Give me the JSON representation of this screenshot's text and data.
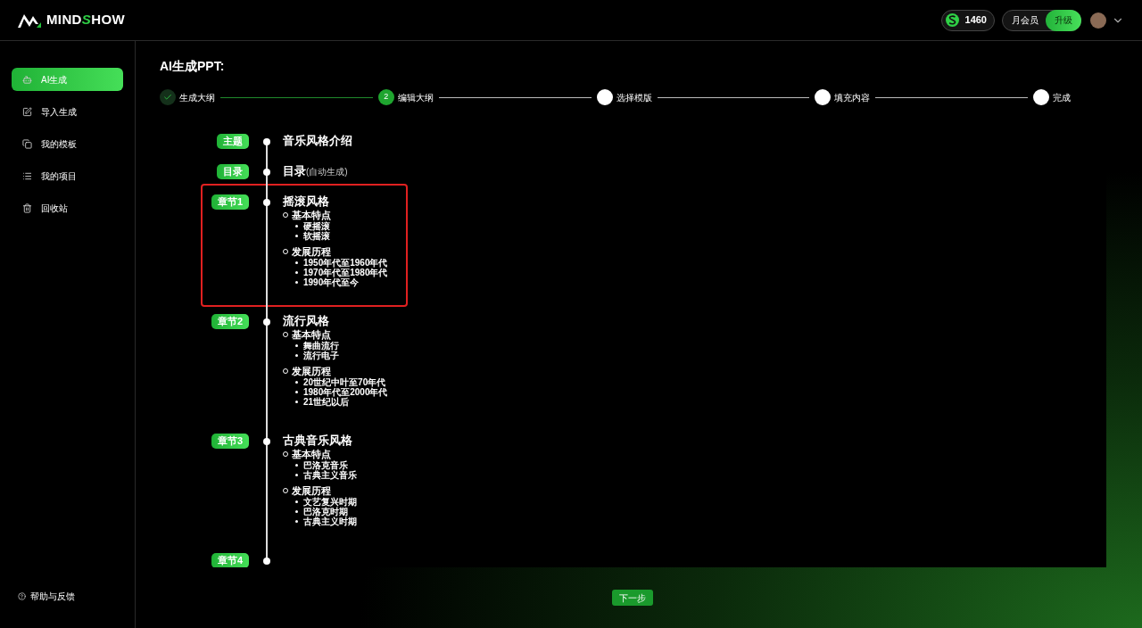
{
  "header": {
    "logo": [
      {
        "text": "MIND",
        "accent": false
      },
      {
        "text": "S",
        "accent": true
      },
      {
        "text": "HOW",
        "accent": false
      }
    ],
    "coins": "1460",
    "membership": "月会员",
    "upgrade": "升级"
  },
  "sidebar": {
    "items": [
      {
        "label": "AI生成",
        "selected": true
      },
      {
        "label": "导入生成",
        "selected": false
      },
      {
        "label": "我的模板",
        "selected": false
      },
      {
        "label": "我的项目",
        "selected": false
      },
      {
        "label": "回收站",
        "selected": false
      }
    ],
    "help": "帮助与反馈"
  },
  "page_title": "AI生成PPT:",
  "steps": [
    {
      "label": "生成大纲",
      "kind": "done"
    },
    {
      "label": "编辑大纲",
      "kind": "current",
      "number": "2"
    },
    {
      "label": "选择模版",
      "kind": "todo"
    },
    {
      "label": "填充内容",
      "kind": "todo"
    },
    {
      "label": "完成",
      "kind": "todo"
    }
  ],
  "outline": [
    {
      "tag": "主题",
      "title": "音乐风格介绍",
      "selected": false
    },
    {
      "tag": "目录",
      "title": "目录",
      "note": "(自动生成)",
      "selected": false
    },
    {
      "tag": "章节1",
      "title": "摇滚风格",
      "selected": true,
      "groups": [
        {
          "title": "基本特点",
          "items": [
            "硬摇滚",
            "软摇滚"
          ]
        },
        {
          "title": "发展历程",
          "items": [
            "1950年代至1960年代",
            "1970年代至1980年代",
            "1990年代至今"
          ]
        }
      ]
    },
    {
      "tag": "章节2",
      "title": "流行风格",
      "selected": false,
      "groups": [
        {
          "title": "基本特点",
          "items": [
            "舞曲流行",
            "流行电子"
          ]
        },
        {
          "title": "发展历程",
          "items": [
            "20世纪中叶至70年代",
            "1980年代至2000年代",
            "21世纪以后"
          ]
        }
      ]
    },
    {
      "tag": "章节3",
      "title": "古典音乐风格",
      "selected": false,
      "groups": [
        {
          "title": "基本特点",
          "items": [
            "巴洛克音乐",
            "古典主义音乐"
          ]
        },
        {
          "title": "发展历程",
          "items": [
            "文艺复兴时期",
            "巴洛克时期",
            "古典主义时期"
          ]
        }
      ]
    },
    {
      "tag": "章节4",
      "selected": false
    }
  ],
  "next_button": "下一步"
}
